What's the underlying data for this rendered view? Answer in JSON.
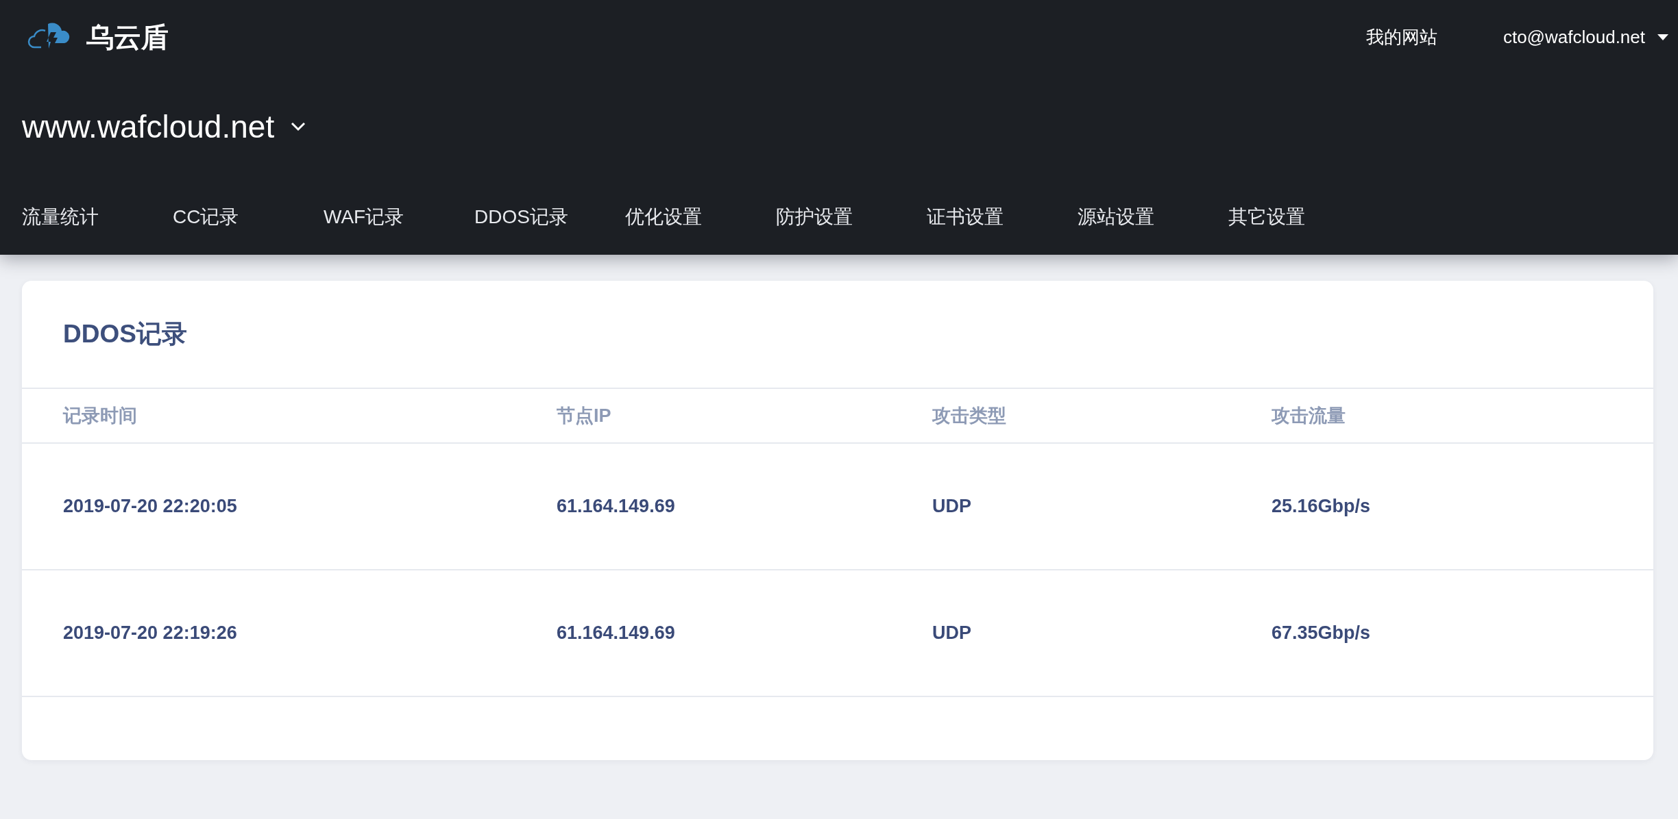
{
  "brand": {
    "name": "乌云盾"
  },
  "top_links": [
    {
      "label": "我的网站",
      "kind": "link"
    },
    {
      "label": "cto@wafcloud.net",
      "kind": "dropdown"
    }
  ],
  "site": {
    "domain": "www.wafcloud.net"
  },
  "nav": [
    {
      "label": "流量统计"
    },
    {
      "label": "CC记录"
    },
    {
      "label": "WAF记录"
    },
    {
      "label": "DDOS记录"
    },
    {
      "label": "优化设置"
    },
    {
      "label": "防护设置"
    },
    {
      "label": "证书设置"
    },
    {
      "label": "源站设置"
    },
    {
      "label": "其它设置"
    }
  ],
  "card": {
    "title": "DDOS记录",
    "table": {
      "columns": [
        "记录时间",
        "节点IP",
        "攻击类型",
        "攻击流量"
      ],
      "rows": [
        [
          "2019-07-20 22:20:05",
          "61.164.149.69",
          "UDP",
          "25.16Gbp/s"
        ],
        [
          "2019-07-20 22:19:26",
          "61.164.149.69",
          "UDP",
          "67.35Gbp/s"
        ]
      ]
    }
  }
}
